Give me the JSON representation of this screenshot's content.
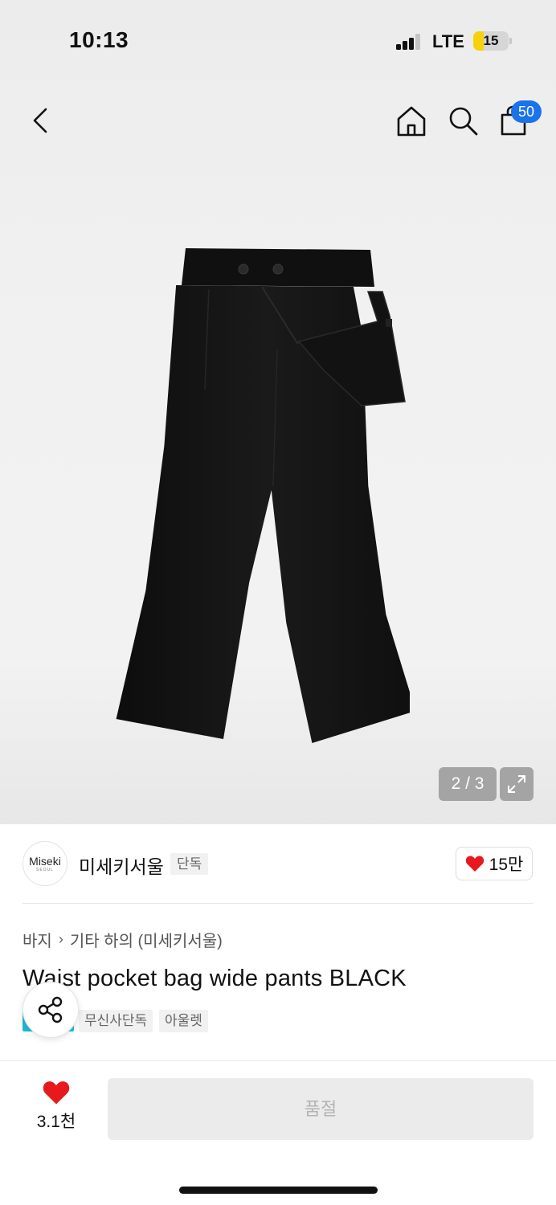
{
  "status_bar": {
    "time": "10:13",
    "network": "LTE",
    "battery": "15",
    "battery_level": 0.15,
    "signal_bars": 3
  },
  "header": {
    "back_icon": "chevron-left-icon",
    "home_icon": "home-icon",
    "search_icon": "search-icon",
    "cart_icon": "shopping-bag-icon",
    "cart_count": "50"
  },
  "gallery": {
    "indicator": "2 / 3",
    "expand_icon": "expand-icon"
  },
  "brand": {
    "logo_text": "Miseki",
    "logo_sub": "SEOUL",
    "name": "미세키서울",
    "exclusive_tag": "단독",
    "like_count": "15만"
  },
  "product": {
    "breadcrumb": [
      "바지",
      "기타 하의 (미세키서울)"
    ],
    "title": "Waist pocket bag wide pants BLACK",
    "tags": [
      "무신사단독",
      "아울렛"
    ]
  },
  "actions": {
    "like_count": "3.1천",
    "soldout_label": "품절"
  },
  "colors": {
    "accent_blue": "#1a73e8",
    "heart_red": "#e8191c",
    "battery_yellow": "#f7d20a"
  }
}
